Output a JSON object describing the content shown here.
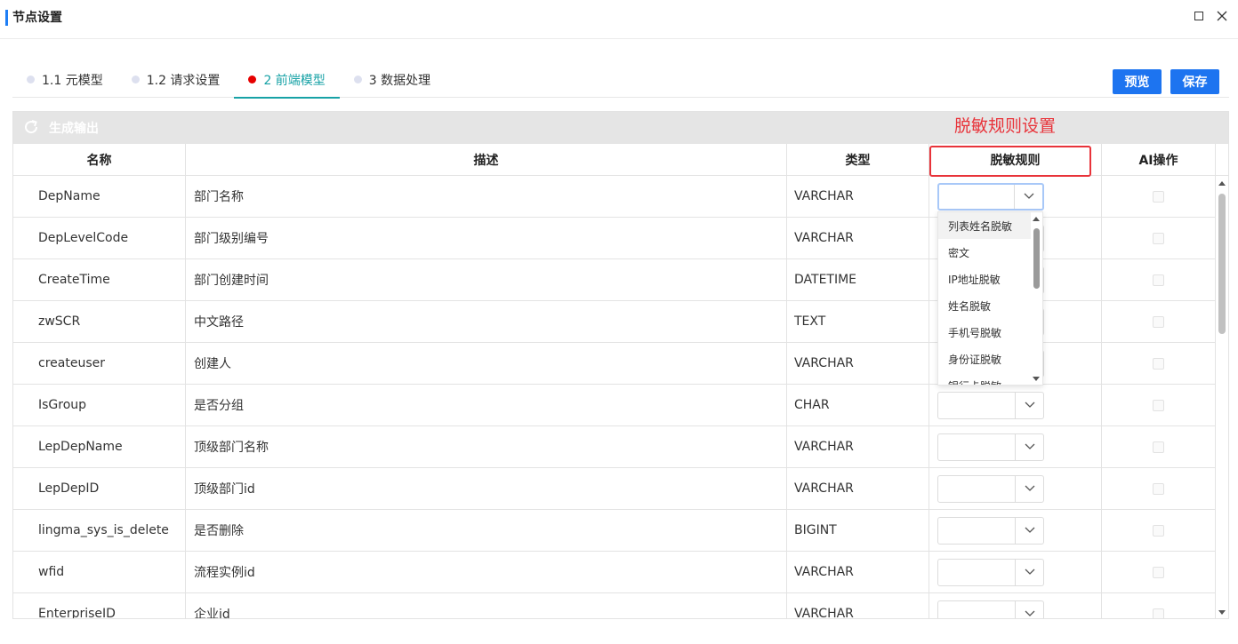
{
  "window": {
    "title": "节点设置"
  },
  "tabs": [
    {
      "label": "1.1 元模型",
      "active": false
    },
    {
      "label": "1.2 请求设置",
      "active": false
    },
    {
      "label": "2 前端模型",
      "active": true
    },
    {
      "label": "3 数据处理",
      "active": false
    }
  ],
  "actions": {
    "preview_label": "预览",
    "save_label": "保存"
  },
  "toolbar": {
    "generate_label": "生成输出"
  },
  "table": {
    "headers": {
      "name": "名称",
      "desc": "描述",
      "type": "类型",
      "rule": "脱敏规则",
      "ai": "AI操作"
    },
    "rows": [
      {
        "name": "DepName",
        "desc": "部门名称",
        "type": "VARCHAR"
      },
      {
        "name": "DepLevelCode",
        "desc": "部门级别编号",
        "type": "VARCHAR"
      },
      {
        "name": "CreateTime",
        "desc": "部门创建时间",
        "type": "DATETIME"
      },
      {
        "name": "zwSCR",
        "desc": "中文路径",
        "type": "TEXT"
      },
      {
        "name": "createuser",
        "desc": "创建人",
        "type": "VARCHAR"
      },
      {
        "name": "IsGroup",
        "desc": "是否分组",
        "type": "CHAR"
      },
      {
        "name": "LepDepName",
        "desc": "顶级部门名称",
        "type": "VARCHAR"
      },
      {
        "name": "LepDepID",
        "desc": "顶级部门id",
        "type": "VARCHAR"
      },
      {
        "name": "lingma_sys_is_delete",
        "desc": "是否删除",
        "type": "BIGINT"
      },
      {
        "name": "wfid",
        "desc": "流程实例id",
        "type": "VARCHAR"
      },
      {
        "name": "EnterpriseID",
        "desc": "企业id",
        "type": "VARCHAR"
      }
    ]
  },
  "dropdown": {
    "options": [
      "列表姓名脱敏",
      "密文",
      "IP地址脱敏",
      "姓名脱敏",
      "手机号脱敏",
      "身份证脱敏",
      "银行卡脱敏"
    ]
  },
  "annotation": {
    "label": "脱敏规则设置",
    "color": "#e8333a"
  },
  "colors": {
    "accent": "#1d74f0",
    "active_tab": "#17a2a6",
    "active_dot": "#e60000"
  },
  "icons": {
    "refresh": "refresh-icon",
    "chevron": "chevron-down-icon",
    "maximize": "maximize-icon",
    "close": "close-icon"
  }
}
